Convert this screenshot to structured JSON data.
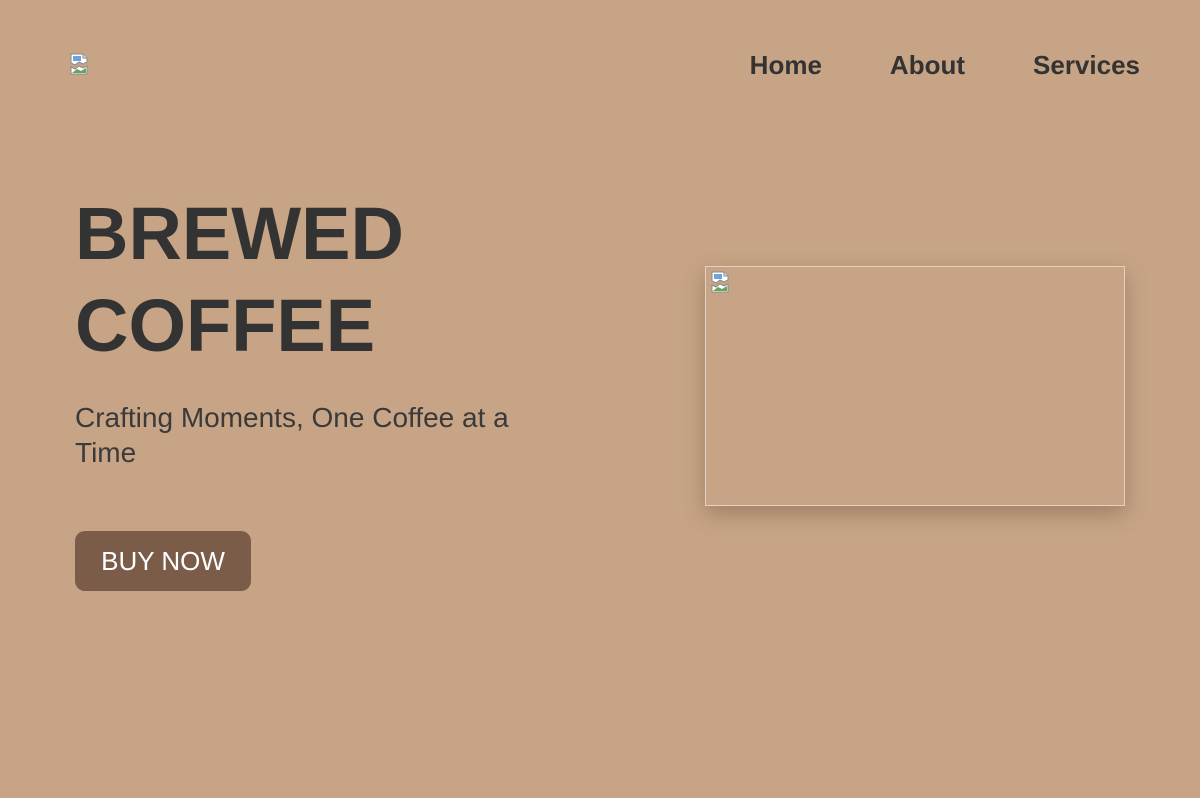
{
  "header": {
    "logo_icon": "broken-image-icon",
    "nav": {
      "home_label": "Home",
      "about_label": "About",
      "services_label": "Services"
    }
  },
  "hero": {
    "title_line1": "BREWED",
    "title_line2": "COFFEE",
    "tagline": "Crafting Moments, One Coffee at a Time",
    "cta_label": "BUY NOW",
    "image_icon": "broken-image-icon"
  },
  "colors": {
    "background": "#c7a486",
    "text": "#333333",
    "button": "#7a5c49",
    "button_text": "#ffffff"
  }
}
